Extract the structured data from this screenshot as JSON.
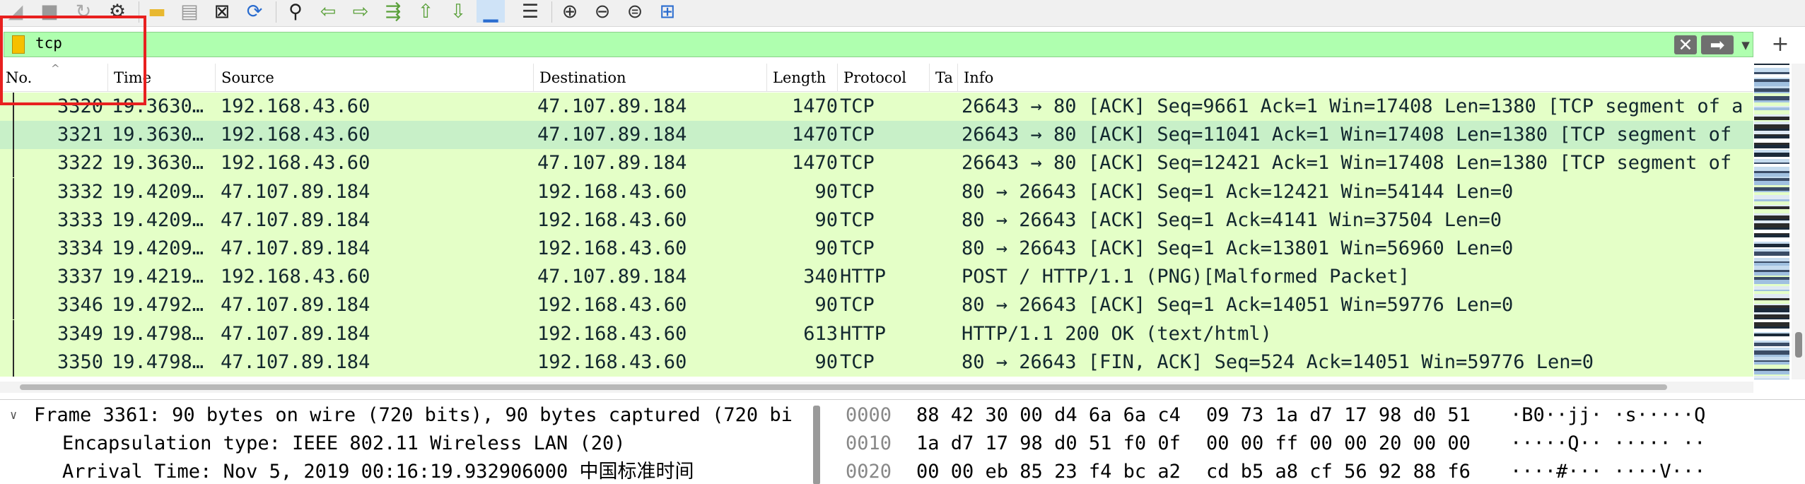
{
  "filter": {
    "text": "tcp"
  },
  "toolbar": {
    "icons": [
      "shark-fin-icon",
      "stop-icon",
      "restart-icon",
      "options-icon",
      "open-folder-icon",
      "save-file-icon",
      "close-file-icon",
      "reload-icon",
      "find-icon",
      "go-back-icon",
      "go-forward-icon",
      "go-to-packet-icon",
      "go-first-icon",
      "go-last-icon",
      "autoscroll-icon",
      "colorize-icon",
      "zoom-in-icon",
      "zoom-out-icon",
      "zoom-reset-icon",
      "resize-columns-icon"
    ]
  },
  "packet_list": {
    "columns": [
      "No.",
      "Time",
      "Source",
      "Destination",
      "Length",
      "Protocol",
      "Ta",
      "Info"
    ],
    "rows": [
      {
        "no": "3320",
        "time": "19.3630…",
        "src": "192.168.43.60",
        "dst": "47.107.89.184",
        "len": "1470",
        "proto": "TCP",
        "info": "26643 → 80 [ACK] Seq=9661 Ack=1 Win=17408 Len=1380 [TCP segment of a"
      },
      {
        "no": "3321",
        "time": "19.3630…",
        "src": "192.168.43.60",
        "dst": "47.107.89.184",
        "len": "1470",
        "proto": "TCP",
        "info": "26643 → 80 [ACK] Seq=11041 Ack=1 Win=17408 Len=1380 [TCP segment of"
      },
      {
        "no": "3322",
        "time": "19.3630…",
        "src": "192.168.43.60",
        "dst": "47.107.89.184",
        "len": "1470",
        "proto": "TCP",
        "info": "26643 → 80 [ACK] Seq=12421 Ack=1 Win=17408 Len=1380 [TCP segment of"
      },
      {
        "no": "3332",
        "time": "19.4209…",
        "src": "47.107.89.184",
        "dst": "192.168.43.60",
        "len": "90",
        "proto": "TCP",
        "info": "80 → 26643 [ACK] Seq=1 Ack=12421 Win=54144 Len=0"
      },
      {
        "no": "3333",
        "time": "19.4209…",
        "src": "47.107.89.184",
        "dst": "192.168.43.60",
        "len": "90",
        "proto": "TCP",
        "info": "80 → 26643 [ACK] Seq=1 Ack=4141 Win=37504 Len=0"
      },
      {
        "no": "3334",
        "time": "19.4209…",
        "src": "47.107.89.184",
        "dst": "192.168.43.60",
        "len": "90",
        "proto": "TCP",
        "info": "80 → 26643 [ACK] Seq=1 Ack=13801 Win=56960 Len=0"
      },
      {
        "no": "3337",
        "time": "19.4219…",
        "src": "192.168.43.60",
        "dst": "47.107.89.184",
        "len": "340",
        "proto": "HTTP",
        "info": "POST / HTTP/1.1  (PNG)[Malformed Packet]"
      },
      {
        "no": "3346",
        "time": "19.4792…",
        "src": "47.107.89.184",
        "dst": "192.168.43.60",
        "len": "90",
        "proto": "TCP",
        "info": "80 → 26643 [ACK] Seq=1 Ack=14051 Win=59776 Len=0"
      },
      {
        "no": "3349",
        "time": "19.4798…",
        "src": "47.107.89.184",
        "dst": "192.168.43.60",
        "len": "613",
        "proto": "HTTP",
        "info": "HTTP/1.1 200 OK  (text/html)"
      },
      {
        "no": "3350",
        "time": "19.4798…",
        "src": "47.107.89.184",
        "dst": "192.168.43.60",
        "len": "90",
        "proto": "TCP",
        "info": "80 → 26643 [FIN, ACK] Seq=524 Ack=14051 Win=59776 Len=0"
      }
    ]
  },
  "details": {
    "lines": [
      "Frame 3361: 90 bytes on wire (720 bits), 90 bytes captured (720 bi",
      "Encapsulation type: IEEE 802.11 Wireless LAN (20)",
      "Arrival Time: Nov  5, 2019 00:16:19.932906000 中国标准时间"
    ]
  },
  "hex": {
    "rows": [
      {
        "offset": "0000",
        "bytes1": "88 42 30 00 d4 6a 6a c4",
        "bytes2": "09 73 1a d7 17 98 d0 51",
        "ascii": "·B0··jj· ·s·····Q"
      },
      {
        "offset": "0010",
        "bytes1": "1a d7 17 98 d0 51 f0 0f",
        "bytes2": "00 00 ff 00 00 20 00 00",
        "ascii": "·····Q·· ····· ··"
      },
      {
        "offset": "0020",
        "bytes1": "00 00 eb 85 23 f4 bc a2",
        "bytes2": "cd b5 a8 cf 56 92 88 f6",
        "ascii": "····#··· ····V···"
      }
    ]
  },
  "colors": {
    "filter_bg": "#afffaf",
    "row_bg": "#e4ffc7",
    "row_selected_bg": "#c8f0c8",
    "annotation": "#e8201f"
  }
}
